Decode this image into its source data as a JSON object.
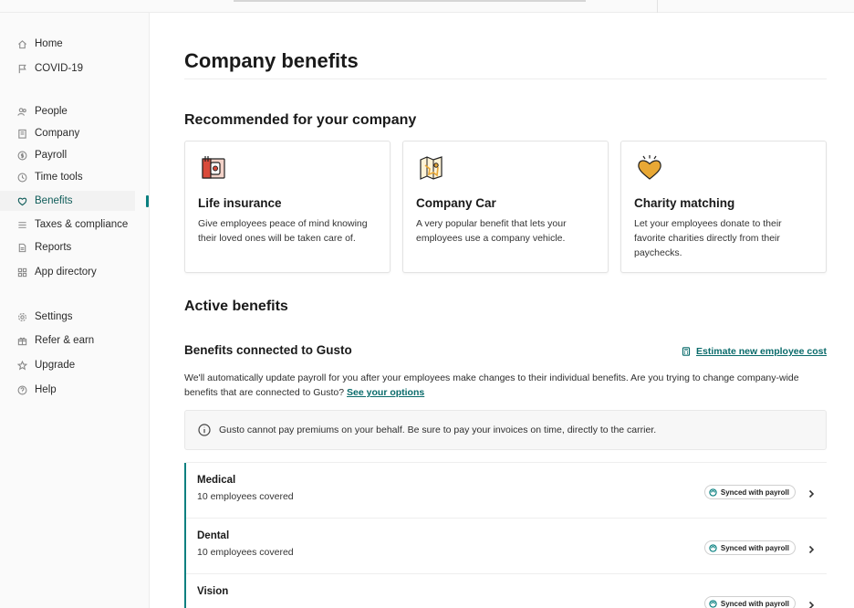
{
  "sidebar": {
    "items": [
      {
        "label": "Home",
        "icon": "home-icon"
      },
      {
        "label": "COVID-19",
        "icon": "flag-icon"
      },
      {
        "label": "People",
        "icon": "people-icon"
      },
      {
        "label": "Company",
        "icon": "building-icon"
      },
      {
        "label": "Payroll",
        "icon": "dollar-circle-icon"
      },
      {
        "label": "Time tools",
        "icon": "clock-icon"
      },
      {
        "label": "Benefits",
        "icon": "heart-shield-icon",
        "active": true
      },
      {
        "label": "Taxes & compliance",
        "icon": "list-icon"
      },
      {
        "label": "Reports",
        "icon": "document-icon"
      },
      {
        "label": "App directory",
        "icon": "grid-icon"
      },
      {
        "label": "Settings",
        "icon": "gear-icon"
      },
      {
        "label": "Refer & earn",
        "icon": "gift-icon"
      },
      {
        "label": "Upgrade",
        "icon": "star-icon"
      },
      {
        "label": "Help",
        "icon": "help-icon"
      }
    ]
  },
  "main": {
    "title": "Company benefits",
    "recommended_heading": "Recommended for your company",
    "cards": [
      {
        "title": "Life insurance",
        "desc": "Give employees peace of mind knowing their loved ones will be taken care of.",
        "icon": "life-insurance-icon"
      },
      {
        "title": "Company Car",
        "desc": "A very popular benefit that lets your employees use a company vehicle.",
        "icon": "map-car-icon"
      },
      {
        "title": "Charity matching",
        "desc": "Let your employees donate to their favorite charities directly from their paychecks.",
        "icon": "heart-icon"
      }
    ],
    "active_heading": "Active benefits",
    "connected_heading": "Benefits connected to Gusto",
    "estimate_link": "Estimate new employee cost",
    "info_text": "We'll automatically update payroll for you after your employees make changes to their individual benefits. Are you trying to change company-wide benefits that are connected to Gusto?",
    "info_link": "See your options",
    "notice": "Gusto cannot pay premiums on your behalf. Be sure to pay your invoices on time, directly to the carrier.",
    "benefits": [
      {
        "name": "Medical",
        "coverage": "10 employees covered",
        "badge": "Synced with payroll"
      },
      {
        "name": "Dental",
        "coverage": "10 employees covered",
        "badge": "Synced with payroll"
      },
      {
        "name": "Vision",
        "coverage": "",
        "badge": "Synced with payroll"
      }
    ]
  },
  "colors": {
    "accent": "#0a8080",
    "link": "#0a6b6b",
    "gold": "#e8a835",
    "red": "#d94a3a"
  }
}
